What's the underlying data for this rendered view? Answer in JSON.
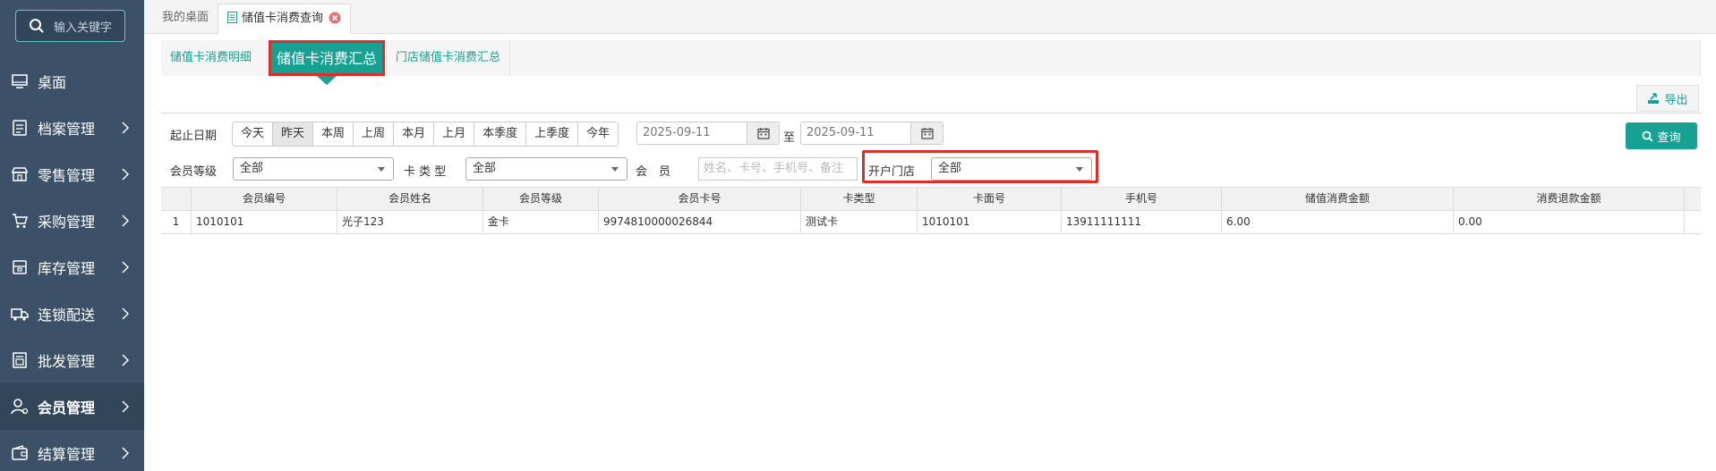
{
  "sidebar": {
    "search_placeholder": "输入关键字",
    "items": [
      {
        "label": "桌面",
        "icon": "monitor-icon",
        "active": false
      },
      {
        "label": "档案管理",
        "icon": "file-icon",
        "active": false
      },
      {
        "label": "零售管理",
        "icon": "store-icon",
        "active": false
      },
      {
        "label": "采购管理",
        "icon": "cart-icon",
        "active": false
      },
      {
        "label": "库存管理",
        "icon": "inventory-icon",
        "active": false
      },
      {
        "label": "连锁配送",
        "icon": "truck-icon",
        "active": false
      },
      {
        "label": "批发管理",
        "icon": "wholesale-icon",
        "active": false
      },
      {
        "label": "会员管理",
        "icon": "user-icon",
        "active": true
      },
      {
        "label": "结算管理",
        "icon": "wallet-icon",
        "active": false
      }
    ]
  },
  "top_tabs": {
    "home": "我的桌面",
    "current": "储值卡消费查询"
  },
  "sub_tabs": [
    "储值卡消费明细",
    "储值卡消费汇总",
    "门店储值卡消费汇总"
  ],
  "toolbar": {
    "export_label": "导出",
    "query_label": "查询"
  },
  "filters": {
    "date_label": "起止日期",
    "date_buttons": [
      "今天",
      "昨天",
      "本周",
      "上周",
      "本月",
      "上月",
      "本季度",
      "上季度",
      "今年"
    ],
    "active_date_button": "昨天",
    "start_date": "2025-09-11",
    "to_label": "至",
    "end_date": "2025-09-11",
    "member_level_label": "会员等级",
    "member_level_value": "全部",
    "card_type_label": "卡 类 型",
    "card_type_value": "全部",
    "member_label": "会　员",
    "member_placeholder": "姓名、卡号、手机号、备注",
    "store_label": "开户门店",
    "store_value": "全部"
  },
  "table": {
    "columns": [
      "",
      "会员编号",
      "会员姓名",
      "会员等级",
      "会员卡号",
      "卡类型",
      "卡面号",
      "手机号",
      "储值消费金额",
      "消费退款金额",
      ""
    ],
    "rows": [
      [
        "1",
        "1010101",
        "光子123",
        "金卡",
        "9974810000026844",
        "测试卡",
        "1010101",
        "13911111111",
        "6.00",
        "0.00",
        ""
      ]
    ]
  },
  "colors": {
    "accent": "#17a192",
    "sidebar": "#3c5168",
    "highlight": "#d9302c"
  }
}
